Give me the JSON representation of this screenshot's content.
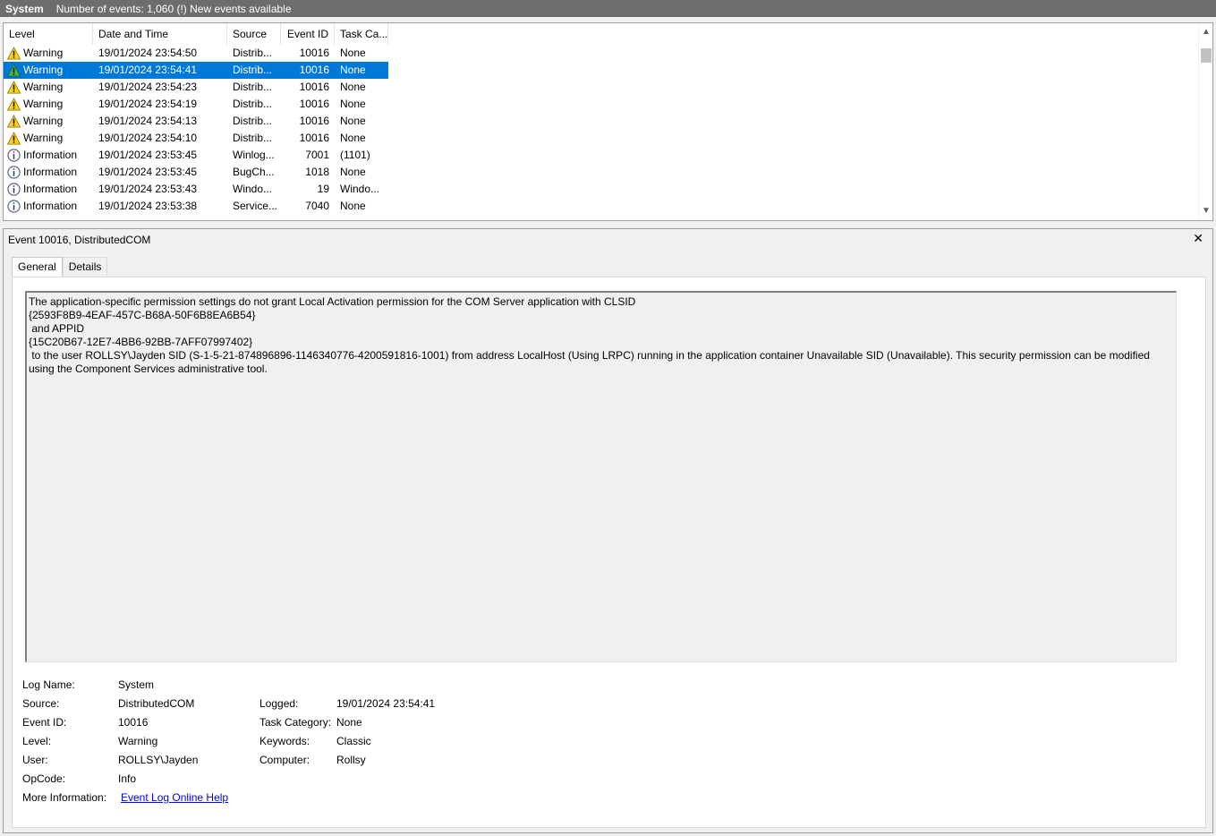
{
  "header": {
    "log_name": "System",
    "info": "Number of events: 1,060 (!) New events available"
  },
  "columns": [
    "Level",
    "Date and Time",
    "Source",
    "Event ID",
    "Task Ca..."
  ],
  "events": [
    {
      "level": "Warning",
      "icon": "warning-icon",
      "datetime": "19/01/2024 23:54:50",
      "source": "Distrib...",
      "id": "10016",
      "task": "None"
    },
    {
      "level": "Warning",
      "icon": "warning-icon",
      "datetime": "19/01/2024 23:54:41",
      "source": "Distrib...",
      "id": "10016",
      "task": "None"
    },
    {
      "level": "Warning",
      "icon": "warning-icon",
      "datetime": "19/01/2024 23:54:23",
      "source": "Distrib...",
      "id": "10016",
      "task": "None"
    },
    {
      "level": "Warning",
      "icon": "warning-icon",
      "datetime": "19/01/2024 23:54:19",
      "source": "Distrib...",
      "id": "10016",
      "task": "None"
    },
    {
      "level": "Warning",
      "icon": "warning-icon",
      "datetime": "19/01/2024 23:54:13",
      "source": "Distrib...",
      "id": "10016",
      "task": "None"
    },
    {
      "level": "Warning",
      "icon": "warning-icon",
      "datetime": "19/01/2024 23:54:10",
      "source": "Distrib...",
      "id": "10016",
      "task": "None"
    },
    {
      "level": "Information",
      "icon": "info-icon",
      "datetime": "19/01/2024 23:53:45",
      "source": "Winlog...",
      "id": "7001",
      "task": "(1101)"
    },
    {
      "level": "Information",
      "icon": "info-icon",
      "datetime": "19/01/2024 23:53:45",
      "source": "BugCh...",
      "id": "1018",
      "task": "None"
    },
    {
      "level": "Information",
      "icon": "info-icon",
      "datetime": "19/01/2024 23:53:43",
      "source": "Windo...",
      "id": "19",
      "task": "Windo..."
    },
    {
      "level": "Information",
      "icon": "info-icon",
      "datetime": "19/01/2024 23:53:38",
      "source": "Service...",
      "id": "7040",
      "task": "None"
    }
  ],
  "selected_index": 1,
  "detail": {
    "title": "Event 10016, DistributedCOM",
    "tabs": [
      "General",
      "Details"
    ],
    "message": "The application-specific permission settings do not grant Local Activation permission for the COM Server application with CLSID \n{2593F8B9-4EAF-457C-B68A-50F6B8EA6B54}\n and APPID \n{15C20B67-12E7-4BB6-92BB-7AFF07997402}\n to the user ROLLSY\\Jayden SID (S-1-5-21-874896896-1146340776-4200591816-1001) from address LocalHost (Using LRPC) running in the application container Unavailable SID (Unavailable). This security permission can be modified using the Component Services administrative tool.",
    "labels": {
      "log_name": "Log Name:",
      "source": "Source:",
      "event_id": "Event ID:",
      "level": "Level:",
      "user": "User:",
      "opcode": "OpCode:",
      "more_info": "More Information:",
      "logged": "Logged:",
      "task_category": "Task Category:",
      "keywords": "Keywords:",
      "computer": "Computer:"
    },
    "values": {
      "log_name": "System",
      "source": "DistributedCOM",
      "event_id": "10016",
      "level": "Warning",
      "user": "ROLLSY\\Jayden",
      "opcode": "Info",
      "more_info": "Event Log Online Help",
      "logged": "19/01/2024 23:54:41",
      "task_category": "None",
      "keywords": "Classic",
      "computer": "Rollsy"
    }
  },
  "colors": {
    "selection": "#0078d7",
    "header_bar": "#6d6d6d",
    "link": "#0000ff"
  }
}
